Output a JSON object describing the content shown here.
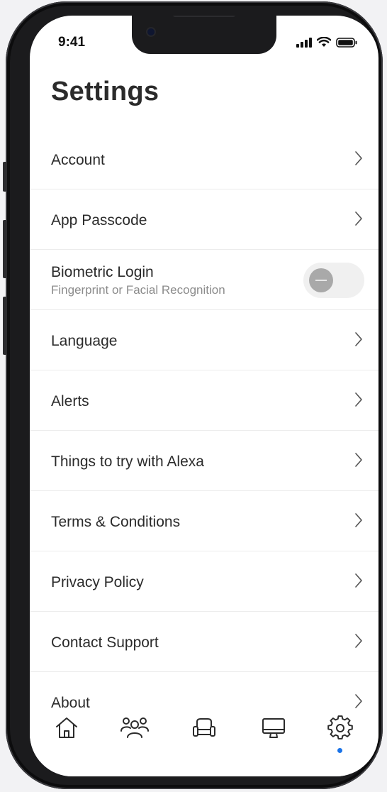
{
  "status_bar": {
    "time": "9:41"
  },
  "page": {
    "title": "Settings"
  },
  "settings": {
    "items": [
      {
        "label": "Account"
      },
      {
        "label": "App Passcode"
      },
      {
        "label": "Biometric Login",
        "sublabel": "Fingerprint or Facial Recognition",
        "toggle": "off"
      },
      {
        "label": "Language"
      },
      {
        "label": "Alerts"
      },
      {
        "label": "Things to try with Alexa"
      },
      {
        "label": "Terms & Conditions"
      },
      {
        "label": "Privacy Policy"
      },
      {
        "label": "Contact Support"
      },
      {
        "label": "About"
      }
    ]
  },
  "tab_bar": {
    "tabs": [
      {
        "icon": "home-icon"
      },
      {
        "icon": "users-icon"
      },
      {
        "icon": "armchair-icon"
      },
      {
        "icon": "monitor-icon"
      },
      {
        "icon": "gear-icon",
        "active": true
      }
    ],
    "active_indicator_color": "#1a73e8"
  }
}
